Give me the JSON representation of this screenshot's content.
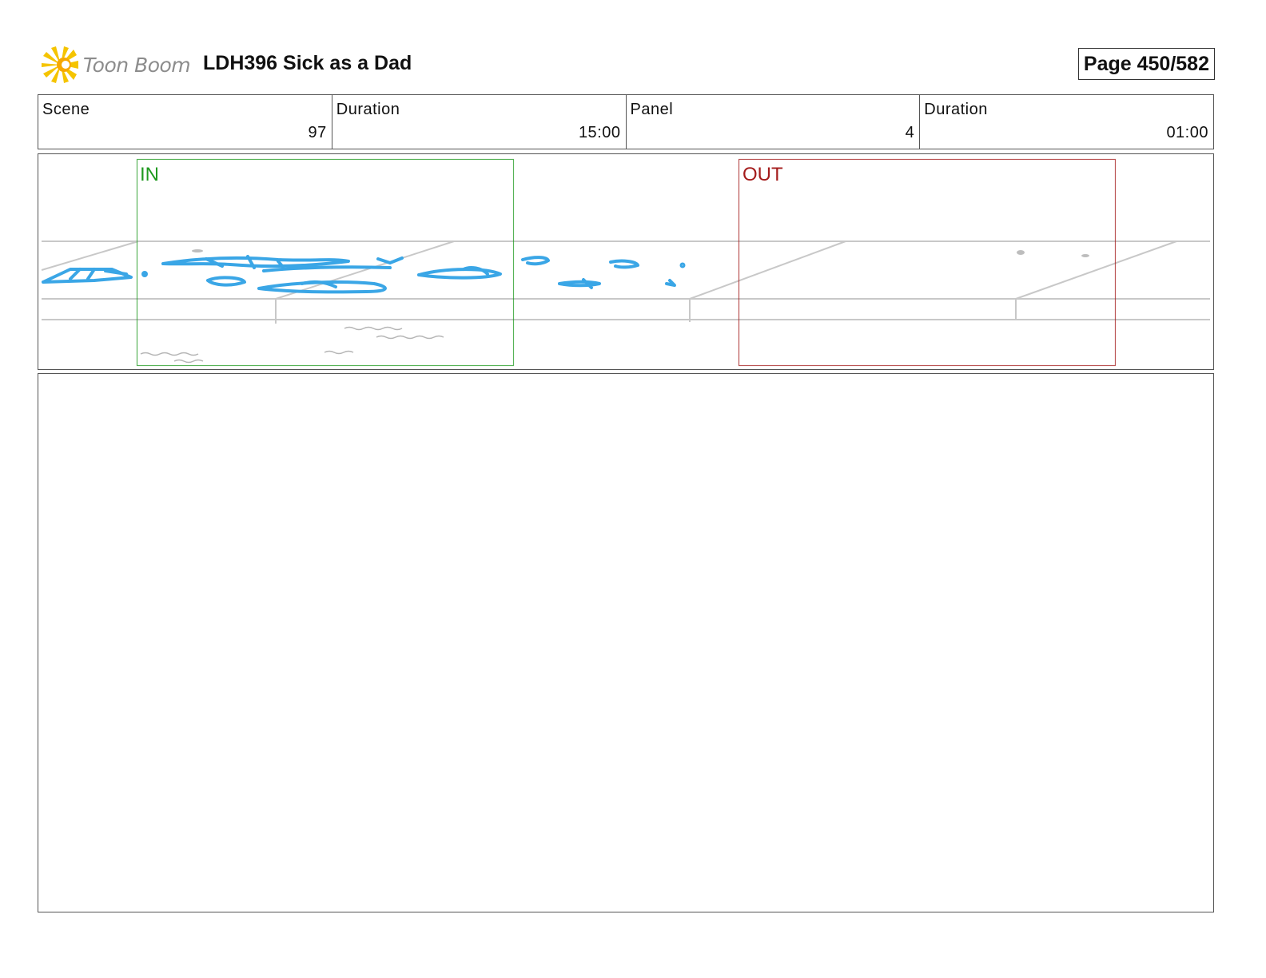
{
  "header": {
    "logo_text": "Toon Boom",
    "title": "LDH396 Sick as a Dad",
    "page": "Page 450/582"
  },
  "info": {
    "scene_label": "Scene",
    "scene_value": "97",
    "scene_duration_label": "Duration",
    "scene_duration_value": "15:00",
    "panel_label": "Panel",
    "panel_value": "4",
    "panel_duration_label": "Duration",
    "panel_duration_value": "01:00"
  },
  "panel": {
    "in_label": "IN",
    "out_label": "OUT",
    "in_color": "#1f9a1f",
    "out_color": "#a41c1c",
    "sketch_color": "#3aa6e6"
  },
  "notes": {
    "text": ""
  }
}
